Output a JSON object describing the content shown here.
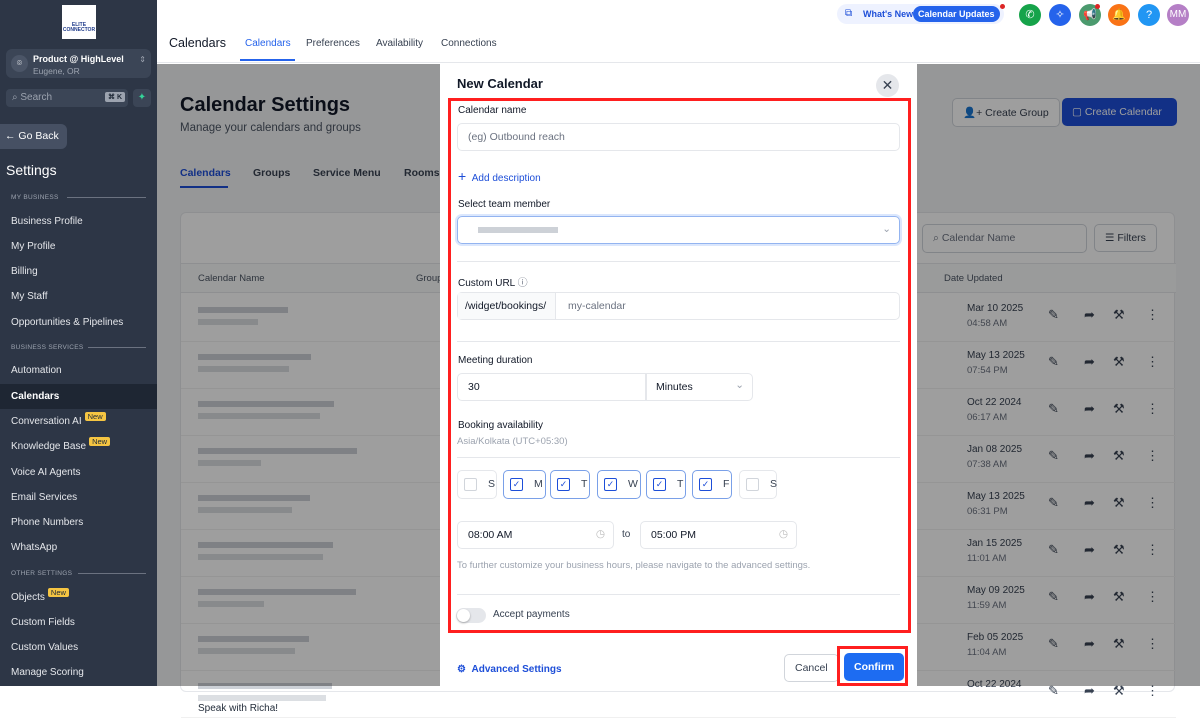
{
  "sidebar": {
    "logo_text": "ELITE CONNECTOR",
    "account_name": "Product @ HighLevel",
    "account_location": "Eugene, OR",
    "search_placeholder": "Search",
    "search_shortcut": "⌘ K",
    "go_back": "Go Back",
    "title": "Settings",
    "sections": [
      {
        "label": "MY BUSINESS"
      },
      {
        "label": "BUSINESS SERVICES"
      },
      {
        "label": "OTHER SETTINGS"
      }
    ],
    "items": [
      {
        "label": "Business Profile"
      },
      {
        "label": "My Profile"
      },
      {
        "label": "Billing"
      },
      {
        "label": "My Staff"
      },
      {
        "label": "Opportunities & Pipelines"
      },
      {
        "label": "Automation"
      },
      {
        "label": "Calendars"
      },
      {
        "label": "Conversation AI",
        "badge": "New"
      },
      {
        "label": "Knowledge Base",
        "badge": "New"
      },
      {
        "label": "Voice AI Agents"
      },
      {
        "label": "Email Services"
      },
      {
        "label": "Phone Numbers"
      },
      {
        "label": "WhatsApp"
      },
      {
        "label": "Objects",
        "badge": "New"
      },
      {
        "label": "Custom Fields"
      },
      {
        "label": "Custom Values"
      },
      {
        "label": "Manage Scoring"
      }
    ]
  },
  "topbar": {
    "title": "Calendars",
    "tabs": [
      "Calendars",
      "Preferences",
      "Availability",
      "Connections"
    ],
    "whats_new": "What's New",
    "calendar_updates": "Calendar Updates",
    "avatar": "MM",
    "help": "?"
  },
  "page": {
    "title": "Calendar Settings",
    "subtitle": "Manage your calendars and groups",
    "tabs": [
      "Calendars",
      "Groups",
      "Service Menu",
      "Rooms"
    ],
    "create_group": "Create Group",
    "create_calendar": "Create Calendar",
    "search_placeholder": "Calendar Name",
    "filters": "Filters",
    "columns": [
      "Calendar Name",
      "Group",
      "Date Updated"
    ],
    "rows": [
      {
        "date": "Mar 10 2025",
        "time": "04:58 AM"
      },
      {
        "date": "May 13 2025",
        "time": "07:54 PM"
      },
      {
        "date": "Oct 22 2024",
        "time": "06:17 AM"
      },
      {
        "date": "Jan 08 2025",
        "time": "07:38 AM"
      },
      {
        "date": "May 13 2025",
        "time": "06:31 PM"
      },
      {
        "date": "Jan 15 2025",
        "time": "11:01 AM"
      },
      {
        "date": "May 09 2025",
        "time": "11:59 AM"
      },
      {
        "date": "Feb 05 2025",
        "time": "11:04 AM"
      },
      {
        "date": "Oct 22 2024",
        "time": ""
      }
    ],
    "last_row_name": "Speak with Richa!"
  },
  "modal": {
    "title": "New Calendar",
    "calendar_name_label": "Calendar name",
    "calendar_name_placeholder": "(eg) Outbound reach",
    "add_description": "Add description",
    "team_member_label": "Select team member",
    "custom_url_label": "Custom URL",
    "url_prefix": "/widget/bookings/",
    "url_placeholder": "my-calendar",
    "duration_label": "Meeting duration",
    "duration_value": "30",
    "duration_unit": "Minutes",
    "availability_label": "Booking availability",
    "timezone": "Asia/Kolkata (UTC+05:30)",
    "days": [
      {
        "l": "S",
        "on": false
      },
      {
        "l": "M",
        "on": true
      },
      {
        "l": "T",
        "on": true
      },
      {
        "l": "W",
        "on": true
      },
      {
        "l": "T",
        "on": true
      },
      {
        "l": "F",
        "on": true
      },
      {
        "l": "S",
        "on": false
      }
    ],
    "start_time": "08:00 AM",
    "to": "to",
    "end_time": "05:00 PM",
    "hint": "To further customize your business hours, please navigate to the advanced settings.",
    "accept_payments": "Accept payments",
    "accept_payments_on": false,
    "advanced_settings": "Advanced Settings",
    "cancel": "Cancel",
    "confirm": "Confirm"
  }
}
